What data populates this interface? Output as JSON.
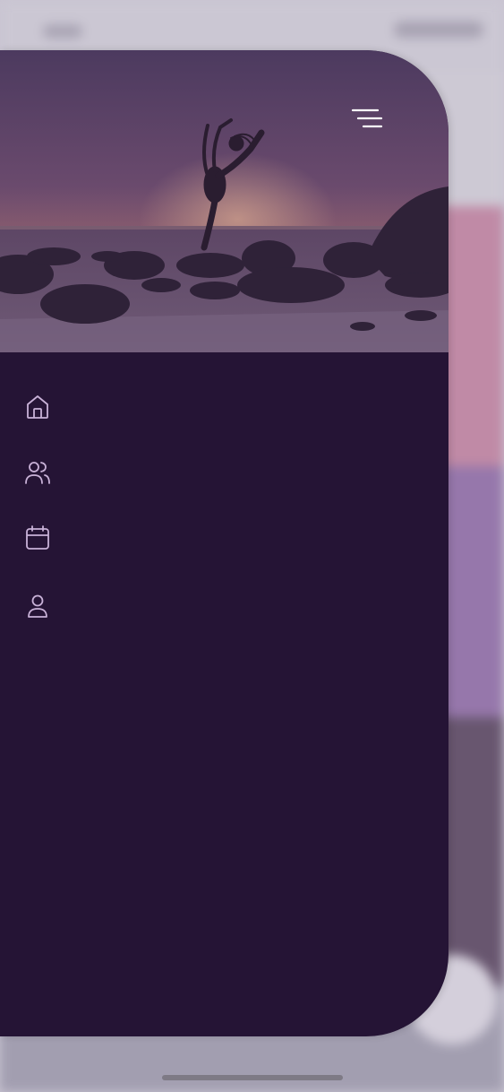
{
  "app": {
    "drawer": {
      "header_image_icon": "dancer-sunset-beach-image",
      "menu_icon": "hamburger-menu-icon"
    },
    "nav": {
      "items": [
        {
          "id": "home",
          "icon": "home-icon",
          "label": ""
        },
        {
          "id": "community",
          "icon": "users-icon",
          "label": ""
        },
        {
          "id": "calendar",
          "icon": "calendar-icon",
          "label": ""
        },
        {
          "id": "profile",
          "icon": "user-icon",
          "label": ""
        }
      ]
    },
    "colors": {
      "drawer_bg": "#251435",
      "icon_stroke": "#c9b2d8",
      "menu_icon": "#ffffff"
    }
  }
}
